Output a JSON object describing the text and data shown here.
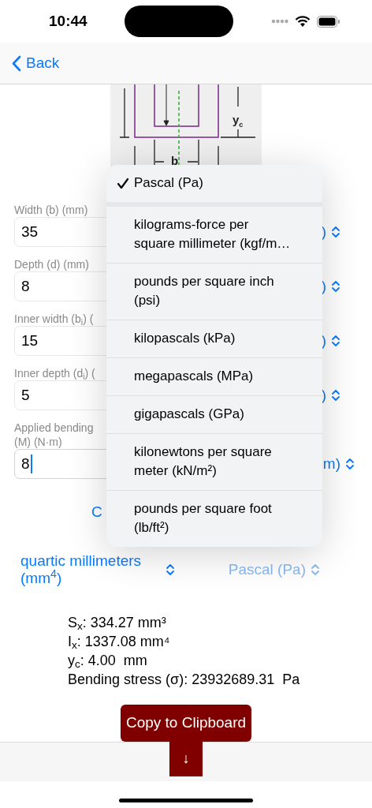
{
  "status_bar": {
    "time": "10:44"
  },
  "nav": {
    "back_label": "Back"
  },
  "diagram": {
    "labels": [
      {
        "main": "y",
        "sub": "c"
      },
      {
        "main": "b"
      }
    ]
  },
  "fields": [
    {
      "label": "Width (b) (mm)",
      "value": "35",
      "focused": false,
      "unit": ")"
    },
    {
      "label": "Depth (d) (mm)",
      "value": "8",
      "focused": false,
      "unit": ")"
    },
    {
      "label": "Inner width (b$_{i}$) (",
      "value": "15",
      "focused": false,
      "unit": ")"
    },
    {
      "label": "Inner depth (d$_{i}$) (",
      "value": "5",
      "focused": false,
      "unit": ")"
    },
    {
      "label": "Applied bending\n(M) (N·m)",
      "value": "8",
      "focused": true,
      "unit": "m)"
    }
  ],
  "action_label": "C",
  "area_unit": {
    "label": "quartic millimeters (mm$^{4}$)",
    "disabled": false
  },
  "stress_unit": {
    "label": "Pascal (Pa)",
    "disabled": true
  },
  "results": [
    "S$_{x}$: 334.27 mm³",
    "I$_{x}$: 1337.08 mm⁴",
    "y$_{c}$: 4.00  mm",
    "Bending stress (σ): 23932689.31  Pa"
  ],
  "copy_button": "Copy to Clipboard",
  "toolbar_button": "↓",
  "menu": [
    {
      "label": "Pascal (Pa)",
      "selected": true
    },
    {
      "label": "kilograms-force per square millimeter (kgf/m…",
      "selected": false
    },
    {
      "label": "pounds per square inch (psi)",
      "selected": false
    },
    {
      "label": "kilopascals (kPa)",
      "selected": false
    },
    {
      "label": "megapascals (MPa)",
      "selected": false
    },
    {
      "label": "gigapascals (GPa)",
      "selected": false
    },
    {
      "label": "kilonewtons per square meter (kN/m²)",
      "selected": false
    },
    {
      "label": "pounds per square foot (lb/ft²)",
      "selected": false
    }
  ]
}
